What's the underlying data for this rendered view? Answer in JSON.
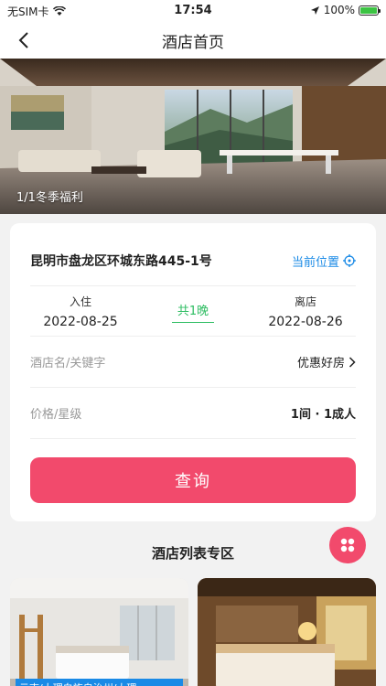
{
  "status_bar": {
    "carrier": "无SIM卡",
    "time": "17:54",
    "battery": "100%",
    "battery_level": 1.0
  },
  "nav": {
    "title": "酒店首页"
  },
  "banner": {
    "caption": "1/1冬季福利"
  },
  "search_card": {
    "address": "昆明市盘龙区环城东路445-1号",
    "locate_label": "当前位置",
    "checkin_label": "入住",
    "checkin_date": "2022-08-25",
    "nights": "共1晚",
    "checkout_label": "离店",
    "checkout_date": "2022-08-26",
    "keyword_placeholder": "酒店名/关键字",
    "deals_label": "优惠好房",
    "price_placeholder": "价格/星级",
    "rooms_guests": "1间 · 1成人",
    "search_button": "查询"
  },
  "hotel_list": {
    "title": "酒店列表专区",
    "items": [
      {
        "tag": "云南/大理白族自治州/大理"
      }
    ]
  },
  "colors": {
    "accent": "#f24a6c",
    "link": "#1a8ae6",
    "green": "#2ebd62"
  }
}
